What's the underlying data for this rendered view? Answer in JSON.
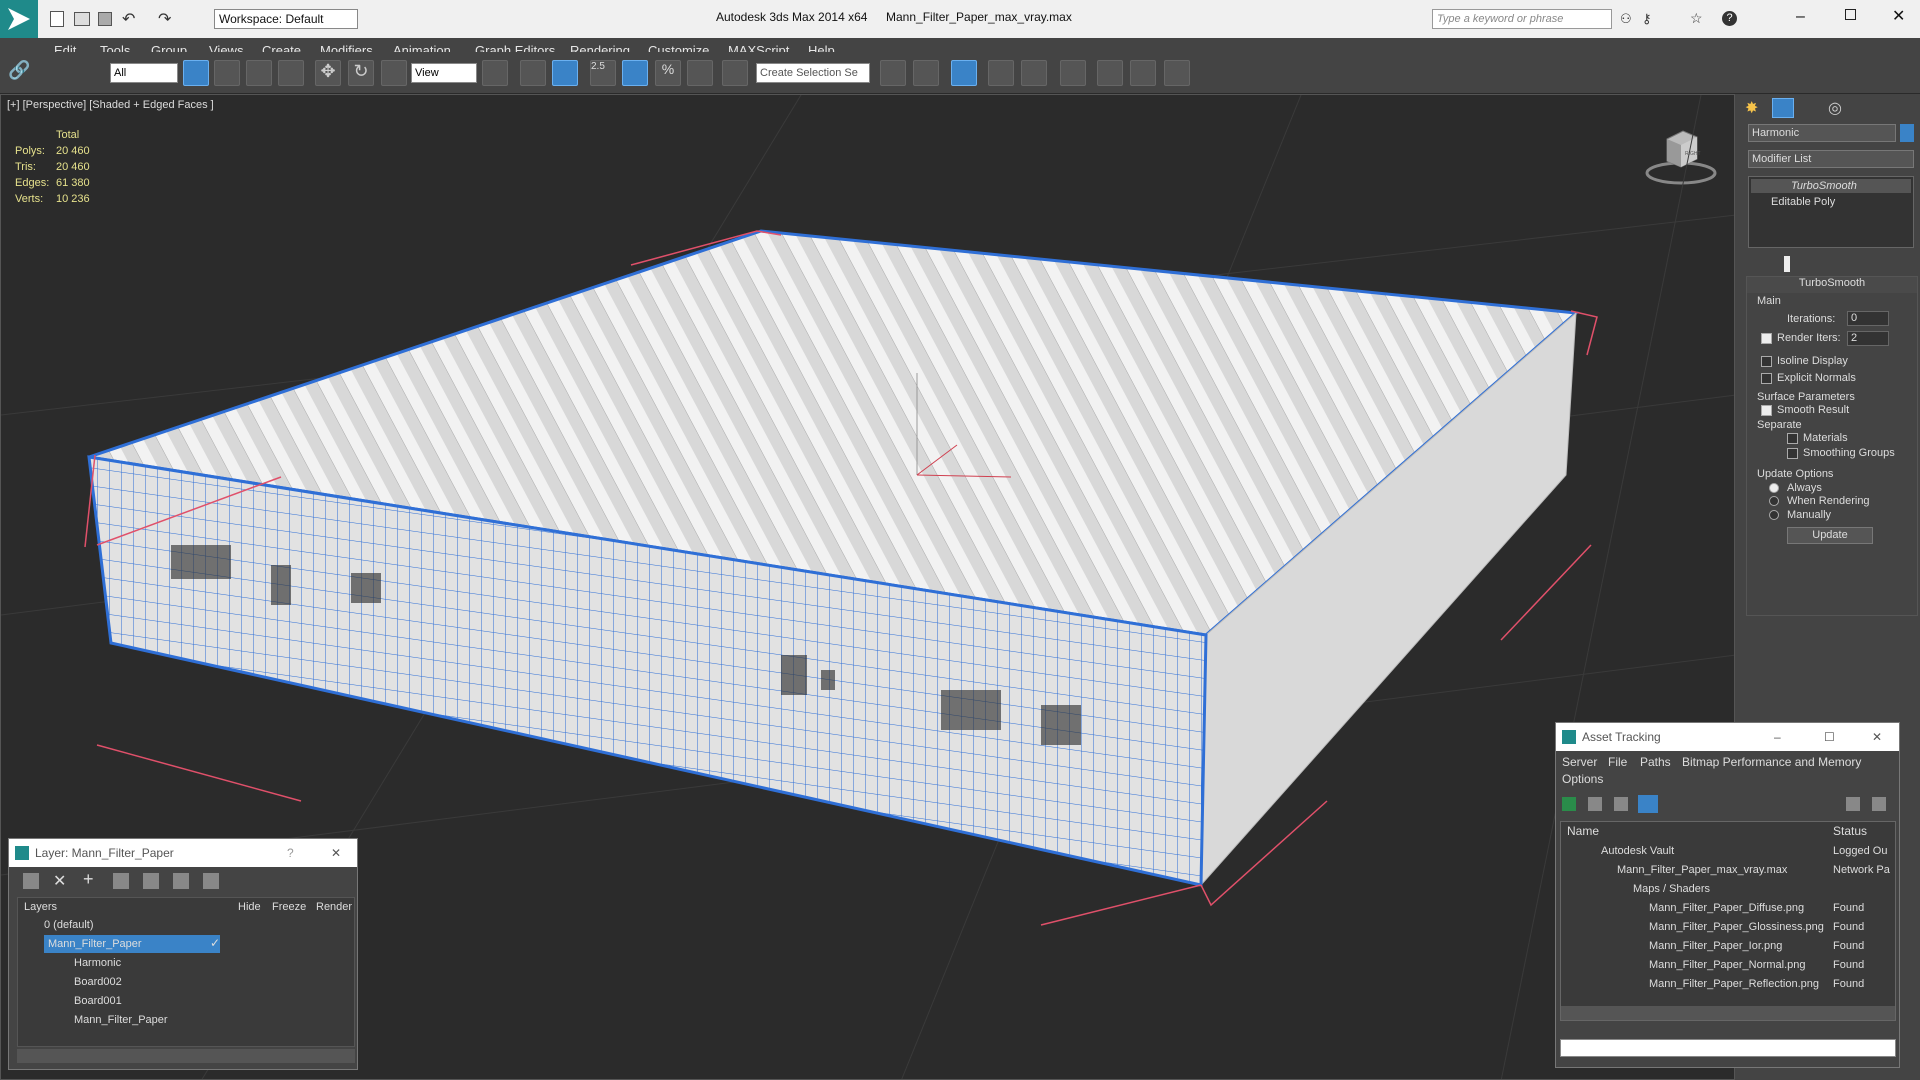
{
  "titlebar": {
    "workspace_label": "Workspace: Default",
    "app_title": "Autodesk 3ds Max  2014 x64",
    "file_title": "Mann_Filter_Paper_max_vray.max",
    "search_placeholder": "Type a keyword or phrase"
  },
  "menu": [
    "Edit",
    "Tools",
    "Group",
    "Views",
    "Create",
    "Modifiers",
    "Animation",
    "Graph Editors",
    "Rendering",
    "Customize",
    "MAXScript",
    "Help"
  ],
  "toolbar": {
    "filter_value": "All",
    "refcoord_value": "View",
    "snap_value": "2.5",
    "selection_set_placeholder": "Create Selection Se"
  },
  "viewport": {
    "label": "[+] [Perspective] [Shaded + Edged Faces ]",
    "stats": {
      "header": "Total",
      "rows": [
        {
          "label": "Polys:",
          "value": "20 460"
        },
        {
          "label": "Tris:",
          "value": "20 460"
        },
        {
          "label": "Edges:",
          "value": "61 380"
        },
        {
          "label": "Verts:",
          "value": "10 236"
        }
      ]
    },
    "viewcube_label": "RIGHT"
  },
  "command_panel": {
    "object_name": "Harmonic",
    "modifier_list": "Modifier List",
    "stack": [
      "TurboSmooth",
      "Editable Poly"
    ],
    "rollout_title": "TurboSmooth",
    "main_label": "Main",
    "iterations_label": "Iterations:",
    "iterations_value": "0",
    "render_iters_label": "Render Iters:",
    "render_iters_value": "2",
    "isoline_label": "Isoline Display",
    "explicit_label": "Explicit Normals",
    "surface_label": "Surface Parameters",
    "smooth_label": "Smooth Result",
    "separate_label": "Separate",
    "materials_label": "Materials",
    "smoothing_label": "Smoothing Groups",
    "update_options_label": "Update Options",
    "always_label": "Always",
    "when_rendering_label": "When Rendering",
    "manually_label": "Manually",
    "update_button": "Update"
  },
  "layer_window": {
    "title": "Layer: Mann_Filter_Paper",
    "columns": [
      "Layers",
      "Hide",
      "Freeze",
      "Render"
    ],
    "rows": [
      "0 (default)",
      "Mann_Filter_Paper",
      "Harmonic",
      "Board002",
      "Board001",
      "Mann_Filter_Paper"
    ]
  },
  "asset_window": {
    "title": "Asset Tracking",
    "menu": [
      "Server",
      "File",
      "Paths",
      "Bitmap Performance and Memory",
      "Options"
    ],
    "columns": [
      "Name",
      "Status"
    ],
    "rows": [
      {
        "name": "Autodesk Vault",
        "status": "Logged Ou"
      },
      {
        "name": "Mann_Filter_Paper_max_vray.max",
        "status": "Network Pa"
      },
      {
        "name": "Maps / Shaders",
        "status": ""
      },
      {
        "name": "Mann_Filter_Paper_Diffuse.png",
        "status": "Found"
      },
      {
        "name": "Mann_Filter_Paper_Glossiness.png",
        "status": "Found"
      },
      {
        "name": "Mann_Filter_Paper_Ior.png",
        "status": "Found"
      },
      {
        "name": "Mann_Filter_Paper_Normal.png",
        "status": "Found"
      },
      {
        "name": "Mann_Filter_Paper_Reflection.png",
        "status": "Found"
      }
    ]
  },
  "colors": {
    "accent": "#3a83c7",
    "stats_text": "#e6e18c",
    "mesh_wire": "#2f6fd6",
    "bbox": "#e0506a"
  }
}
